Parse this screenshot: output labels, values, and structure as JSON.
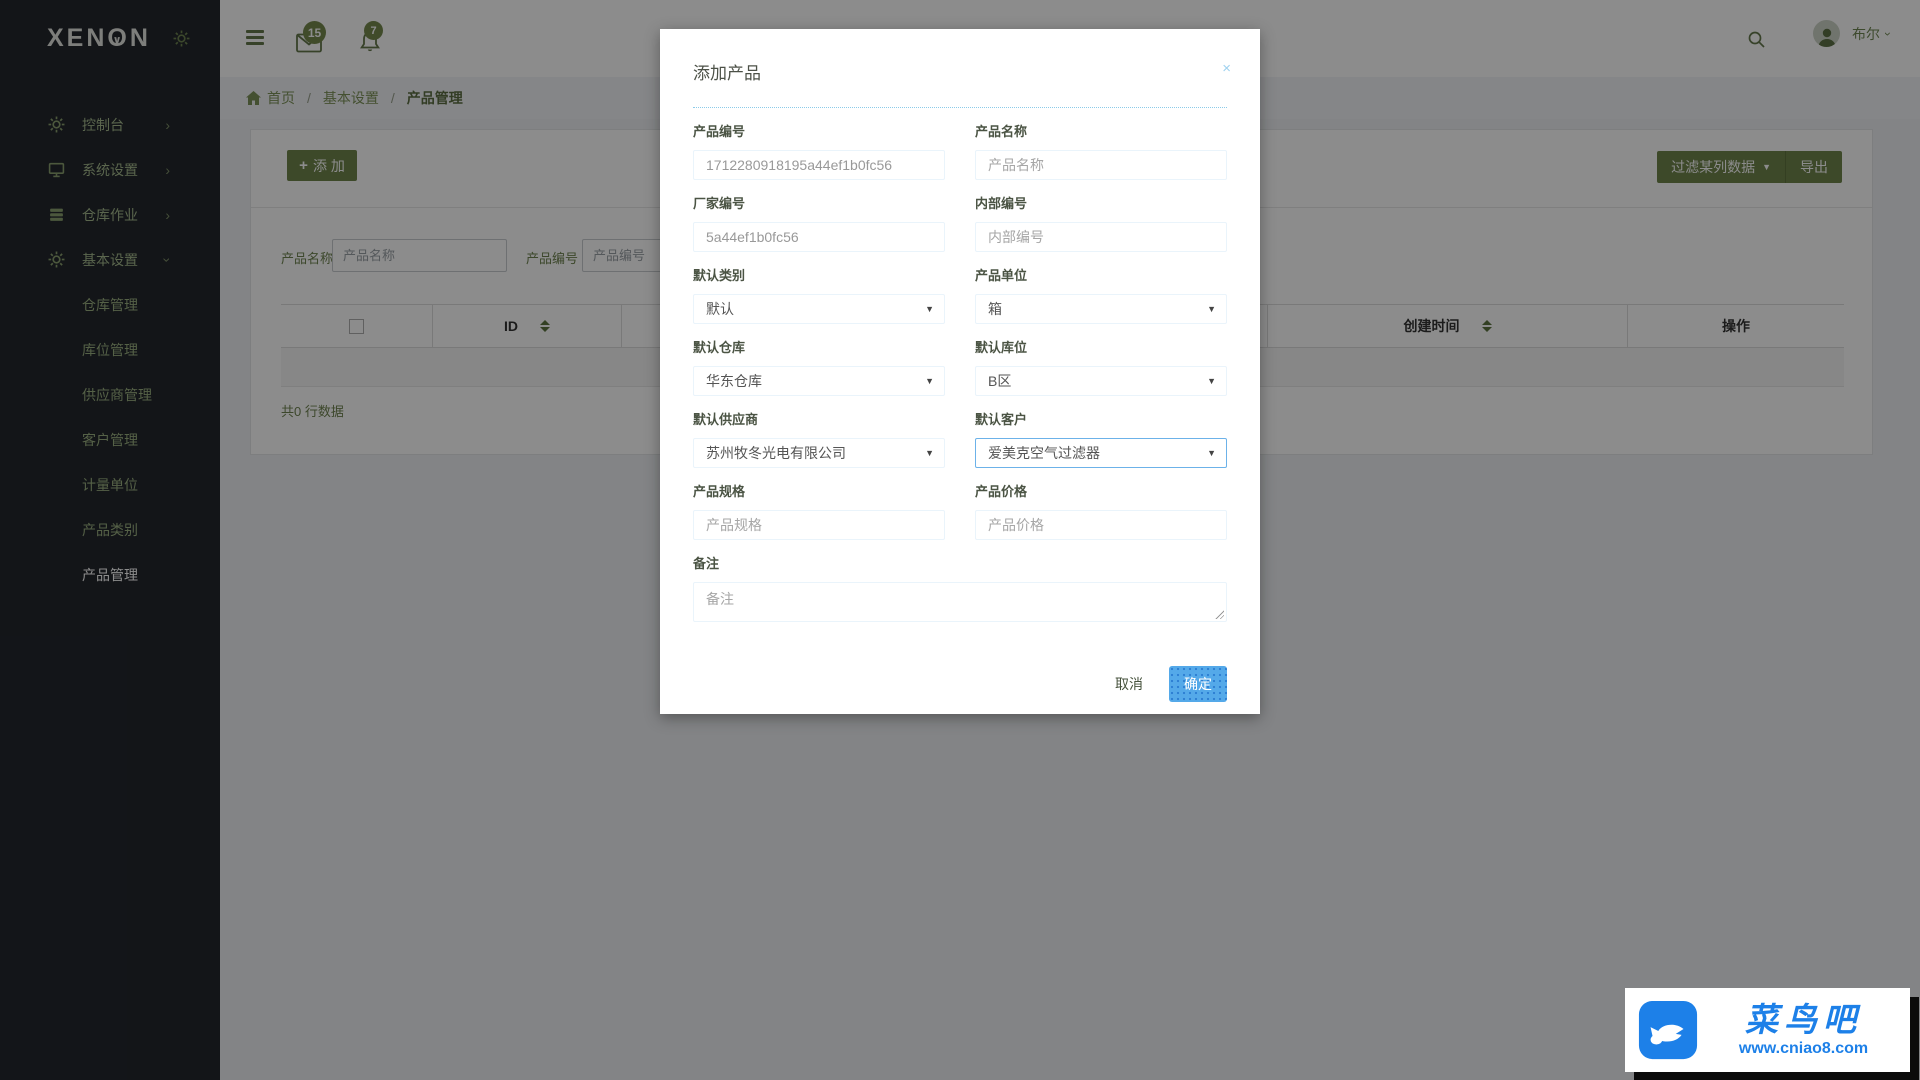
{
  "app": {
    "logo_prefix": "XEN",
    "logo_o": "O",
    "logo_o_mark": "∨",
    "logo_suffix": "N"
  },
  "topbar": {
    "mail_badge": "15",
    "bell_badge": "7",
    "user_name": "布尔"
  },
  "sidebar": {
    "items": [
      {
        "label": "控制台"
      },
      {
        "label": "系统设置"
      },
      {
        "label": "仓库作业"
      },
      {
        "label": "基本设置"
      }
    ],
    "subitems": [
      {
        "label": "仓库管理"
      },
      {
        "label": "库位管理"
      },
      {
        "label": "供应商管理"
      },
      {
        "label": "客户管理"
      },
      {
        "label": "计量单位"
      },
      {
        "label": "产品类别"
      },
      {
        "label": "产品管理"
      }
    ]
  },
  "breadcrumb": {
    "home": "首页",
    "section": "基本设置",
    "current": "产品管理"
  },
  "toolbar": {
    "add_icon": "+",
    "add_label": "添 加",
    "filter_label": "过滤某列数据",
    "filter_caret": "▼",
    "export_label": "导出"
  },
  "filters": {
    "name_label": "产品名称",
    "name_placeholder": "产品名称",
    "code_label": "产品编号",
    "code_placeholder": "产品编号"
  },
  "table": {
    "headers": {
      "id": "ID",
      "created": "创建时间",
      "actions": "操作"
    },
    "footer_count": "共0 行数据"
  },
  "modal": {
    "title": "添加产品",
    "close_icon": "×",
    "caret_icon": "▼",
    "fields": {
      "product_code": {
        "label": "产品编号",
        "value": "1712280918195a44ef1b0fc56"
      },
      "product_name": {
        "label": "产品名称",
        "placeholder": "产品名称"
      },
      "factory_code": {
        "label": "厂家编号",
        "value": "5a44ef1b0fc56"
      },
      "internal_code": {
        "label": "内部编号",
        "placeholder": "内部编号"
      },
      "default_category": {
        "label": "默认类别",
        "value": "默认"
      },
      "product_unit": {
        "label": "产品单位",
        "value": "箱"
      },
      "default_warehouse": {
        "label": "默认仓库",
        "value": "华东仓库"
      },
      "default_location": {
        "label": "默认库位",
        "value": "B区"
      },
      "default_supplier": {
        "label": "默认供应商",
        "value": "苏州牧冬光电有限公司"
      },
      "default_customer": {
        "label": "默认客户",
        "value": "爱美克空气过滤器"
      },
      "product_spec": {
        "label": "产品规格",
        "placeholder": "产品规格"
      },
      "product_price": {
        "label": "产品价格",
        "placeholder": "产品价格"
      },
      "remark": {
        "label": "备注",
        "placeholder": "备注"
      }
    },
    "buttons": {
      "cancel": "取消",
      "confirm": "确定"
    }
  },
  "watermark": {
    "title": "菜鸟吧",
    "url": "www.cniao8.com"
  },
  "colors": {
    "theme_green": "#6f854c",
    "badge_green": "#75894e",
    "confirm_blue": "#54a9e9",
    "focus_blue": "#6cb2e9",
    "watermark_blue": "#1d80e8",
    "sidebar_bg": "#23272d"
  }
}
